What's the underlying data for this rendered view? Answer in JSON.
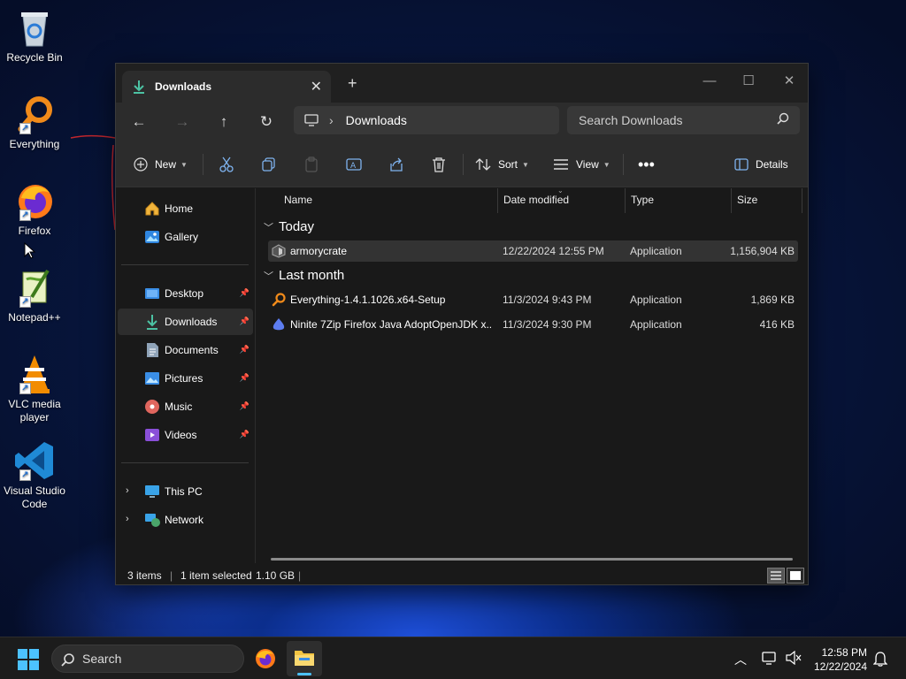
{
  "desktop": {
    "icons": [
      {
        "label": "Recycle Bin"
      },
      {
        "label": "Everything"
      },
      {
        "label": "Firefox"
      },
      {
        "label": "Notepad++"
      },
      {
        "label": "VLC media player"
      },
      {
        "label": "Visual Studio Code"
      }
    ]
  },
  "window": {
    "tab_title": "Downloads",
    "address": "Downloads",
    "search_placeholder": "Search Downloads",
    "toolbar": {
      "new": "New",
      "sort": "Sort",
      "view": "View",
      "details": "Details"
    },
    "sidebar": {
      "items": [
        {
          "label": "Home"
        },
        {
          "label": "Gallery"
        },
        {
          "label": "Desktop"
        },
        {
          "label": "Downloads"
        },
        {
          "label": "Documents"
        },
        {
          "label": "Pictures"
        },
        {
          "label": "Music"
        },
        {
          "label": "Videos"
        },
        {
          "label": "This PC"
        },
        {
          "label": "Network"
        }
      ]
    },
    "columns": [
      "Name",
      "Date modified",
      "Type",
      "Size"
    ],
    "groups": [
      {
        "label": "Today",
        "rows": [
          {
            "name": "armorycrate",
            "date": "12/22/2024 12:55 PM",
            "type": "Application",
            "size": "1,156,904 KB"
          }
        ]
      },
      {
        "label": "Last month",
        "rows": [
          {
            "name": "Everything-1.4.1.1026.x64-Setup",
            "date": "11/3/2024 9:43 PM",
            "type": "Application",
            "size": "1,869 KB"
          },
          {
            "name": "Ninite 7Zip Firefox Java AdoptOpenJDK x...",
            "date": "11/3/2024 9:30 PM",
            "type": "Application",
            "size": "416 KB"
          }
        ]
      }
    ],
    "status": {
      "items": "3 items",
      "selected": "1 item selected",
      "size": "1.10 GB"
    }
  },
  "taskbar": {
    "search_placeholder": "Search",
    "time": "12:58 PM",
    "date": "12/22/2024"
  }
}
